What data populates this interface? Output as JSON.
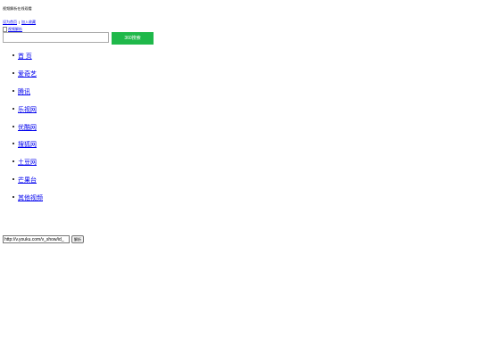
{
  "header": {
    "tagline": "视频解析在线观看",
    "links": [
      {
        "label": "设为首页"
      },
      {
        "label": "加入收藏"
      }
    ],
    "separator": "|",
    "logo_alt": "视频解析"
  },
  "search": {
    "value": "",
    "button_label": "360搜索"
  },
  "nav": {
    "items": [
      {
        "label": "首 页"
      },
      {
        "label": "爱奇艺"
      },
      {
        "label": "腾讯"
      },
      {
        "label": "乐视网"
      },
      {
        "label": "优酷网"
      },
      {
        "label": "搜狐网"
      },
      {
        "label": "土豆网"
      },
      {
        "label": "芒果台"
      },
      {
        "label": "其他视频"
      }
    ]
  },
  "parser": {
    "url_value": "http://v.youku.com/v_show/id_",
    "button_label": "解析"
  },
  "colors": {
    "search_button_bg": "#1fb84a",
    "link": "#0000ee"
  }
}
